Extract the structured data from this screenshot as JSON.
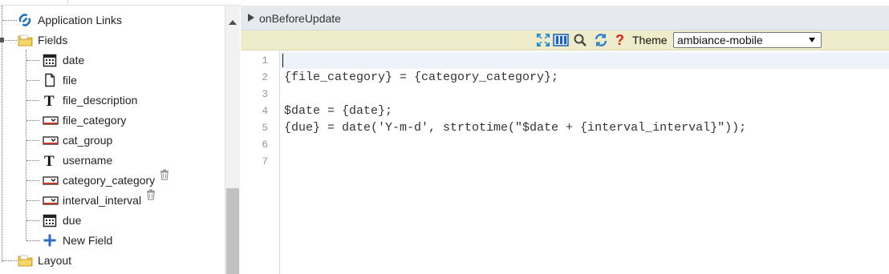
{
  "tree": {
    "application_links": "Application Links",
    "fields": "Fields",
    "field_items": [
      {
        "label": "date",
        "icon": "calendar-icon",
        "deletable": false
      },
      {
        "label": "file",
        "icon": "file-icon",
        "deletable": false
      },
      {
        "label": "file_description",
        "icon": "text-icon",
        "deletable": false
      },
      {
        "label": "file_category",
        "icon": "dropdown-icon",
        "deletable": false
      },
      {
        "label": "cat_group",
        "icon": "dropdown-icon",
        "deletable": false
      },
      {
        "label": "username",
        "icon": "text-icon",
        "deletable": false
      },
      {
        "label": "category_category",
        "icon": "dropdown-icon",
        "deletable": true
      },
      {
        "label": "interval_interval",
        "icon": "dropdown-icon",
        "deletable": true
      },
      {
        "label": "due",
        "icon": "calendar-icon",
        "deletable": false
      },
      {
        "label": "New Field",
        "icon": "plus-icon",
        "deletable": false
      }
    ],
    "layout": "Layout"
  },
  "panel": {
    "title": "onBeforeUpdate",
    "theme_label": "Theme",
    "theme_value": "ambiance-mobile"
  },
  "editor": {
    "line_numbers": [
      "1",
      "2",
      "3",
      "4",
      "5",
      "6",
      "7"
    ],
    "lines": [
      "",
      "{file_category} = {category_category};",
      "",
      "$date = {date};",
      "{due} = date('Y-m-d', strtotime(\"$date + {interval_interval}\"));",
      "",
      ""
    ]
  },
  "colors": {
    "header_bg": "#e6e9ee",
    "toolbar_bg": "#efeccb",
    "active_line": "#eef3fa",
    "icon_blue": "#1f6fbf",
    "help_red": "#d9261c",
    "folder_yellow": "#f2c94c"
  }
}
